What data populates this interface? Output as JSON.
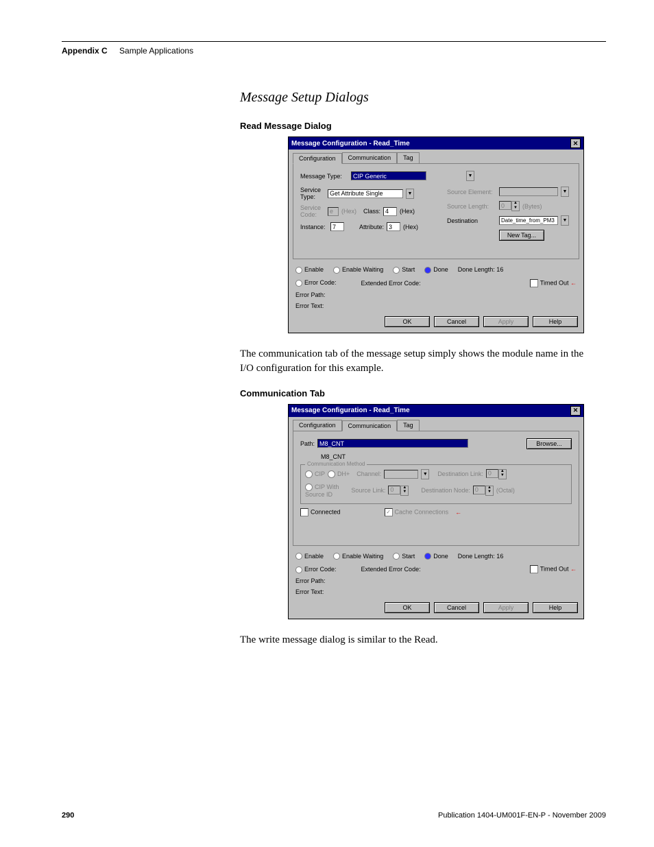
{
  "header": {
    "section": "Appendix C",
    "title": "Sample Applications"
  },
  "section_title": "Message Setup Dialogs",
  "sub1": "Read Message Dialog",
  "dlg1": {
    "title": "Message Configuration - Read_Time",
    "tabs": {
      "t1": "Configuration",
      "t2": "Communication",
      "t3": "Tag"
    },
    "msg_type_lbl": "Message Type:",
    "msg_type_val": "CIP Generic",
    "svc_type_lbl": "Service\nType:",
    "svc_type_val": "Get Attribute Single",
    "svc_code_lbl": "Service\nCode:",
    "svc_code_val": "e",
    "hex": "(Hex)",
    "class_lbl": "Class:",
    "class_val": "4",
    "inst_lbl": "Instance:",
    "inst_val": "7",
    "attr_lbl": "Attribute:",
    "attr_val": "3",
    "src_elem": "Source Element:",
    "src_len": "Source Length:",
    "src_len_val": "0",
    "bytes": "(Bytes)",
    "dest": "Destination",
    "dest_val": "Date_time_from_PM3",
    "newtag": "New Tag...",
    "enable": "Enable",
    "enable_wait": "Enable Waiting",
    "start": "Start",
    "done": "Done",
    "done_len": "Done Length: 16",
    "err_code": "Error Code:",
    "ext_err": "Extended Error Code:",
    "timed": "Timed Out",
    "err_path": "Error Path:",
    "err_text": "Error Text:",
    "ok": "OK",
    "cancel": "Cancel",
    "apply": "Apply",
    "help": "Help"
  },
  "para1": "The communication tab of the message setup simply shows the module name in the I/O configuration for this example.",
  "sub2": "Communication Tab",
  "dlg2": {
    "title": "Message Configuration - Read_Time",
    "path_lbl": "Path:",
    "path_val": "M8_CNT",
    "path_sub": "M8_CNT",
    "browse": "Browse...",
    "cm_lbl": "Communication Method",
    "cip": "CIP",
    "dh": "DH+",
    "chan": "Channel:",
    "dlink": "Destination Link:",
    "dlink_val": "0",
    "cipw": "CIP With\nSource ID",
    "slink": "Source Link:",
    "slink_val": "0",
    "dnode": "Destination Node:",
    "dnode_val": "0",
    "oct": "(Octal)",
    "connected": "Connected",
    "cache": "Cache Connections",
    "enable": "Enable",
    "enable_wait": "Enable Waiting",
    "start": "Start",
    "done": "Done",
    "done_len": "Done Length: 16",
    "err_code": "Error Code:",
    "ext_err": "Extended Error Code:",
    "timed": "Timed Out",
    "err_path": "Error Path:",
    "err_text": "Error Text:",
    "ok": "OK",
    "cancel": "Cancel",
    "apply": "Apply",
    "help": "Help"
  },
  "para2": "The write message dialog is similar to the Read.",
  "footer": {
    "page": "290",
    "pub": "Publication 1404-UM001F-EN-P - November 2009"
  }
}
